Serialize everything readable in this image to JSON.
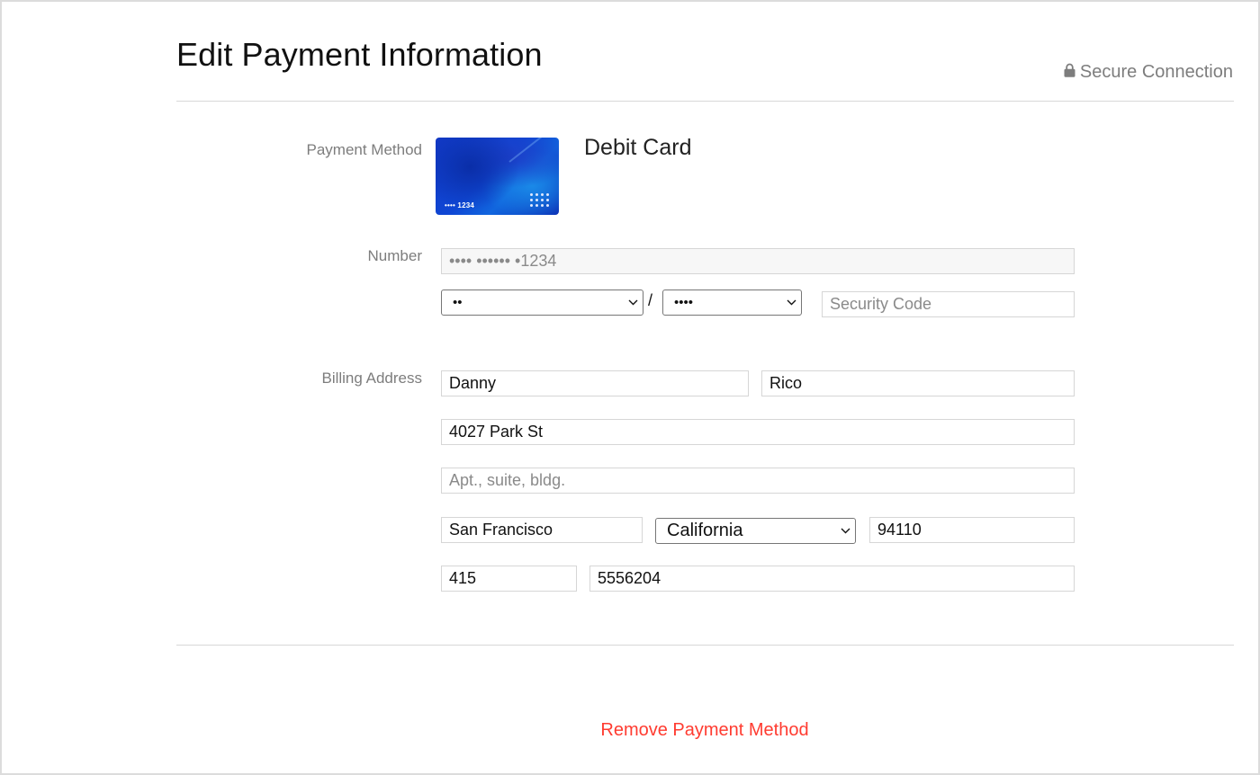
{
  "header": {
    "title": "Edit Payment Information",
    "secure_label": "Secure Connection",
    "secure_icon": "lock-icon"
  },
  "payment_method": {
    "label": "Payment Method",
    "card_last4_display": "•••• 1234",
    "card_type": "Debit Card",
    "card_icon": "card-image"
  },
  "number": {
    "label": "Number",
    "value": "•••• •••••• •1234",
    "expiry_month": "••",
    "expiry_separator": "/",
    "expiry_year": "••••",
    "security_code_placeholder": "Security Code",
    "security_code_value": ""
  },
  "billing": {
    "label": "Billing Address",
    "first_name": "Danny",
    "last_name": "Rico",
    "street": "4027 Park St",
    "apt_placeholder": "Apt., suite, bldg.",
    "apt_value": "",
    "city": "San Francisco",
    "state": "California",
    "zip": "94110",
    "area_code": "415",
    "phone": "5556204"
  },
  "actions": {
    "remove_label": "Remove Payment Method",
    "remove_color": "#ff3b30"
  }
}
